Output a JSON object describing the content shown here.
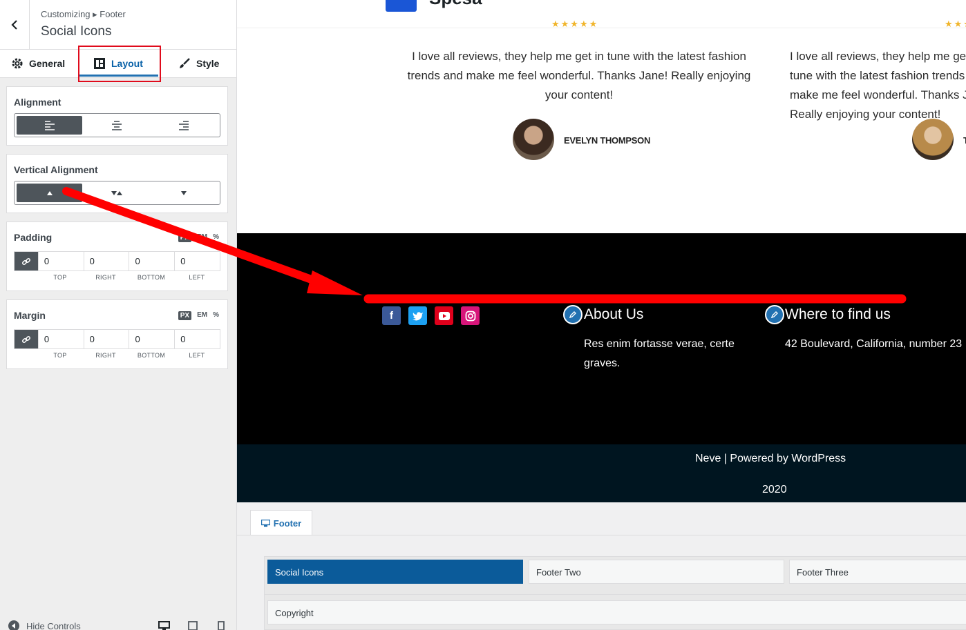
{
  "sidebar": {
    "breadcrumb": "Customizing ▸ Footer",
    "title": "Social Icons",
    "tabs": {
      "general": "General",
      "layout": "Layout",
      "style": "Style"
    },
    "alignment": {
      "title": "Alignment",
      "selected": "left"
    },
    "vertical_alignment": {
      "title": "Vertical Alignment",
      "selected": "top"
    },
    "padding": {
      "title": "Padding",
      "units": [
        "PX",
        "EM",
        "%"
      ],
      "selected_unit": "PX",
      "values": [
        "0",
        "0",
        "0",
        "0"
      ],
      "labels": [
        "TOP",
        "RIGHT",
        "BOTTOM",
        "LEFT"
      ]
    },
    "margin": {
      "title": "Margin",
      "units": [
        "PX",
        "EM",
        "%"
      ],
      "selected_unit": "PX",
      "values": [
        "0",
        "0",
        "0",
        "0"
      ],
      "labels": [
        "TOP",
        "RIGHT",
        "BOTTOM",
        "LEFT"
      ]
    },
    "hide_controls": "Hide Controls"
  },
  "preview": {
    "stars": "★★★★★",
    "quote_1": "I love all reviews, they help me get in tune with the latest fashion trends and make me feel wonderful. Thanks Jane! Really enjoying your content!",
    "quote_2": "I love all reviews, they help me get in tune with the latest fashion trends and make me feel wonderful. Thanks Jane! Really enjoying your content!",
    "author_1": "EVELYN THOMPSON",
    "author_2": "T",
    "footer_widgets": {
      "about_title": "About Us",
      "about_text": "Res enim fortasse verae, certe graves.",
      "where_title": "Where to find us",
      "where_text": "42 Boulevard, California, number 23"
    },
    "powered_by": "Neve | Powered by WordPress",
    "year": "2020"
  },
  "builder": {
    "tab_label": "Footer",
    "row_items": [
      "Social Icons",
      "Footer Two",
      "Footer Three"
    ],
    "bottom_row_item": "Copyright"
  },
  "colors": {
    "accent": "#2271b1",
    "highlight_red": "#e00b1c",
    "facebook": "#3b5998",
    "twitter": "#1da1f2",
    "youtube": "#e0001b",
    "instagram": "#e4405f"
  }
}
